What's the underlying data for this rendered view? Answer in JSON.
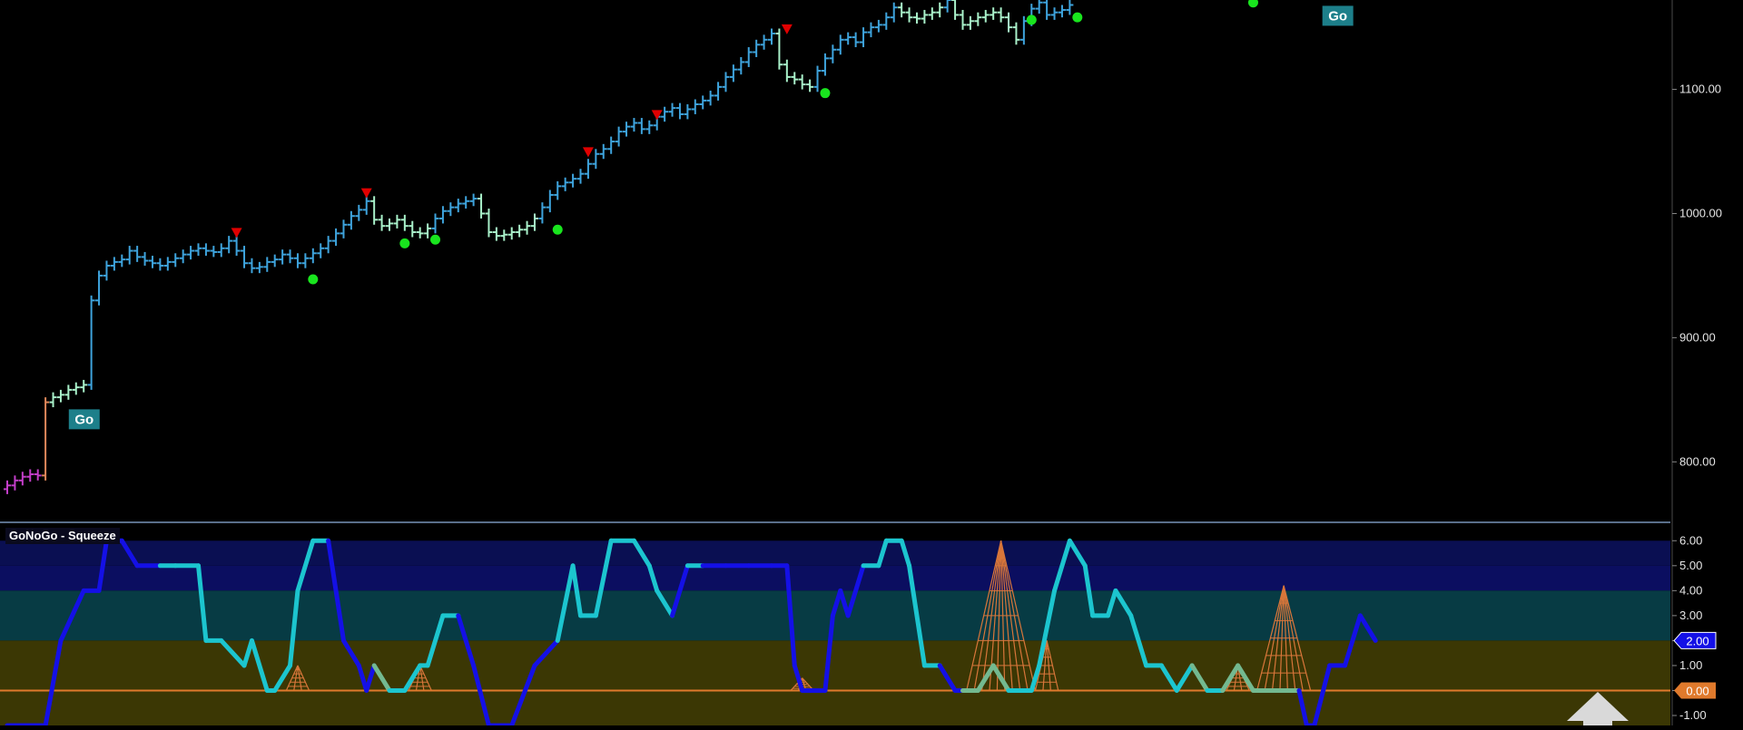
{
  "chart_data": [
    {
      "type": "ohlc",
      "title": "",
      "ylim": [
        752,
        1172
      ],
      "y_ticks": [
        800,
        900,
        1000,
        1100
      ],
      "y_tick_labels": [
        "800.00",
        "900.00",
        "1000.00",
        "1100.00"
      ],
      "colors": {
        "go": "#3ea3dc",
        "go_weak": "#a8f0c9",
        "nogo": "#c33ec9",
        "nogo_weak": "#e0b0e8",
        "neutral": "#e0875a",
        "down_triangle": "#e00000",
        "up_dot": "#19e51e",
        "badge_bg": "#1d7f8a"
      },
      "bar_segments": [
        {
          "start": 0,
          "closes": [
            781,
            785,
            788,
            790,
            789
          ],
          "color": "nogo"
        },
        {
          "start": 5,
          "closes": [
            848
          ],
          "color": "neutral"
        },
        {
          "start": 6,
          "closes": [
            852,
            854,
            858,
            860,
            862
          ],
          "color": "go_weak"
        },
        {
          "start": 11,
          "closes": [
            930,
            950,
            958,
            961,
            963,
            970,
            965,
            962,
            960,
            958,
            961,
            964,
            967,
            970,
            972,
            970,
            969,
            972,
            978,
            970,
            960,
            956,
            957,
            961,
            963,
            967,
            964,
            960,
            964,
            968,
            972,
            978,
            984,
            991,
            998,
            1003,
            1010
          ],
          "color": "go"
        },
        {
          "start": 48,
          "closes": [
            995,
            990,
            992,
            995,
            990,
            985,
            984,
            988
          ],
          "color": "go_weak"
        },
        {
          "start": 56,
          "closes": [
            996,
            1002,
            1005,
            1008,
            1010,
            1012
          ],
          "color": "go"
        },
        {
          "start": 62,
          "closes": [
            1000,
            985,
            982,
            983,
            985,
            987,
            990,
            996
          ],
          "color": "go_weak"
        },
        {
          "start": 70,
          "closes": [
            1005,
            1015,
            1022,
            1025,
            1028,
            1032,
            1040,
            1048,
            1052,
            1058,
            1066,
            1070,
            1073,
            1068,
            1071,
            1078,
            1082,
            1085,
            1080,
            1084,
            1088,
            1091,
            1095,
            1102,
            1110,
            1116,
            1122,
            1130,
            1136,
            1140,
            1145
          ],
          "color": "go"
        },
        {
          "start": 101,
          "closes": [
            1120,
            1110,
            1108,
            1104,
            1102
          ],
          "color": "go_weak"
        },
        {
          "start": 106,
          "closes": [
            1115,
            1125,
            1132,
            1140,
            1142,
            1138,
            1146,
            1150,
            1152,
            1158,
            1166
          ],
          "color": "go"
        },
        {
          "start": 117,
          "closes": [
            1162,
            1158,
            1157,
            1160,
            1162,
            1166
          ],
          "color": "go_weak"
        },
        {
          "start": 123,
          "closes": [
            1172
          ],
          "color": "go"
        },
        {
          "start": 124,
          "closes": [
            1160,
            1152,
            1155,
            1158,
            1160,
            1162,
            1158
          ],
          "color": "go_weak"
        },
        {
          "start": 131,
          "closes": [
            1150,
            1140
          ],
          "color": "go_weak"
        },
        {
          "start": 133,
          "closes": [
            1155,
            1165,
            1170
          ],
          "color": "go"
        },
        {
          "start": 136,
          "closes": [
            1160,
            1162,
            1164
          ],
          "color": "go"
        },
        {
          "start": 139,
          "closes": [
            1168
          ],
          "color": "go"
        }
      ],
      "down_triangles": [
        {
          "bar": 30,
          "y": 984
        },
        {
          "bar": 47,
          "y": 1016
        },
        {
          "bar": 76,
          "y": 1049
        },
        {
          "bar": 85,
          "y": 1079
        },
        {
          "bar": 102,
          "y": 1148
        }
      ],
      "up_dots": [
        {
          "bar": 40,
          "y": 947
        },
        {
          "bar": 52,
          "y": 976
        },
        {
          "bar": 56,
          "y": 979
        },
        {
          "bar": 72,
          "y": 987
        },
        {
          "bar": 107,
          "y": 1097
        },
        {
          "bar": 134,
          "y": 1156
        },
        {
          "bar": 140,
          "y": 1158
        },
        {
          "bar": 163,
          "y": 1170
        }
      ],
      "badges": [
        {
          "label": "Go",
          "bar": 9,
          "y": 835
        },
        {
          "label": "Go",
          "bar": 173,
          "y": 1160
        }
      ]
    },
    {
      "type": "line",
      "title": "GoNoGo - Squeeze",
      "ylim": [
        -1.4,
        6.7
      ],
      "y_ticks": [
        6,
        5,
        4,
        3,
        2,
        1,
        0,
        -1
      ],
      "y_tick_labels": [
        "6.00",
        "5.00",
        "4.00",
        "3.00",
        "2.00",
        "1.00",
        "0.00",
        "-1.00"
      ],
      "current_value": "2.00",
      "zero_value": "0.00",
      "bands": [
        {
          "from": 5,
          "to": 6,
          "color": "#0a0f52"
        },
        {
          "from": 4,
          "to": 5,
          "color": "#0b0e60"
        },
        {
          "from": 2,
          "to": 4,
          "color": "#073b44"
        },
        {
          "from": -1.4,
          "to": 2,
          "color": "#3b3704"
        }
      ],
      "series": [
        {
          "color_strong": "#1410e6",
          "color_weak": "#1cc5cf",
          "color_flat": "#73b990",
          "x": [
            0,
            5,
            7,
            10,
            12,
            13,
            15,
            17,
            20,
            22,
            25,
            26,
            28,
            31,
            32,
            34,
            35,
            37,
            38,
            40,
            42,
            44,
            46,
            47,
            48,
            50,
            52,
            54,
            55,
            57,
            59,
            61,
            63,
            64,
            66,
            69,
            72,
            74,
            75,
            77,
            79,
            82,
            84,
            85,
            87,
            89,
            91,
            94,
            97,
            100,
            102,
            103,
            104,
            106,
            107,
            108,
            109,
            110,
            112,
            114,
            115,
            117,
            118,
            120,
            122,
            124,
            125,
            127,
            129,
            131,
            134,
            135,
            137,
            139,
            141,
            142,
            144,
            145,
            147,
            149,
            151,
            153,
            155,
            157,
            159,
            161,
            163,
            165,
            167,
            169,
            170,
            171,
            173,
            175,
            177,
            179
          ],
          "y": [
            -1.4,
            -1.4,
            2,
            4,
            4,
            6,
            6,
            5,
            5,
            5,
            5,
            2,
            2,
            1,
            2,
            0,
            0,
            1,
            4,
            6,
            6,
            2,
            1,
            0,
            1,
            0,
            0,
            1,
            1,
            3,
            3,
            1,
            -1.4,
            -1.4,
            -1.4,
            1,
            2,
            5,
            3,
            3,
            6,
            6,
            5,
            4,
            3,
            5,
            5,
            5,
            5,
            5,
            5,
            1,
            0,
            0,
            0,
            3,
            4,
            3,
            5,
            5,
            6,
            6,
            5,
            1,
            1,
            0,
            0,
            0,
            1,
            0,
            0,
            1,
            4,
            6,
            5,
            3,
            3,
            4,
            3,
            1,
            1,
            0,
            1,
            0,
            0,
            1,
            0,
            0,
            0,
            0,
            -1.4,
            -1.4,
            1,
            1,
            3,
            2
          ],
          "state": [
            "strong",
            "strong",
            "strong",
            "strong",
            "strong",
            "strong",
            "strong",
            "strong",
            "strong",
            "weak",
            "weak",
            "weak",
            "weak",
            "weak",
            "weak",
            "weak",
            "weak",
            "weak",
            "weak",
            "weak",
            "weak",
            "strong",
            "strong",
            "strong",
            "strong",
            "flat",
            "weak",
            "weak",
            "weak",
            "weak",
            "weak",
            "strong",
            "strong",
            "strong",
            "strong",
            "strong",
            "strong",
            "weak",
            "weak",
            "weak",
            "weak",
            "weak",
            "weak",
            "weak",
            "weak",
            "strong",
            "weak",
            "strong",
            "strong",
            "strong",
            "strong",
            "strong",
            "strong",
            "strong",
            "strong",
            "strong",
            "strong",
            "strong",
            "strong",
            "weak",
            "weak",
            "weak",
            "weak",
            "weak",
            "weak",
            "strong",
            "strong",
            "flat",
            "flat",
            "flat",
            "weak",
            "weak",
            "weak",
            "weak",
            "weak",
            "weak",
            "weak",
            "weak",
            "weak",
            "weak",
            "weak",
            "weak",
            "weak",
            "flat",
            "weak",
            "flat",
            "flat",
            "flat",
            "flat",
            "flat",
            "strong",
            "strong",
            "strong",
            "strong",
            "strong",
            "strong"
          ]
        }
      ],
      "squeeze_spikes": [
        {
          "bar": 38,
          "peak": 1
        },
        {
          "bar": 54,
          "peak": 1
        },
        {
          "bar": 104,
          "peak": 0.5
        },
        {
          "bar": 130,
          "peak": 6.0,
          "bars": 9
        },
        {
          "bar": 136,
          "peak": 2.0
        },
        {
          "bar": 161,
          "peak": 1.0
        },
        {
          "bar": 167,
          "peak": 4.2,
          "bars": 7
        }
      ],
      "zero_line_color": "#e07a2c",
      "arrow_icon": "up-arrow-icon"
    }
  ]
}
